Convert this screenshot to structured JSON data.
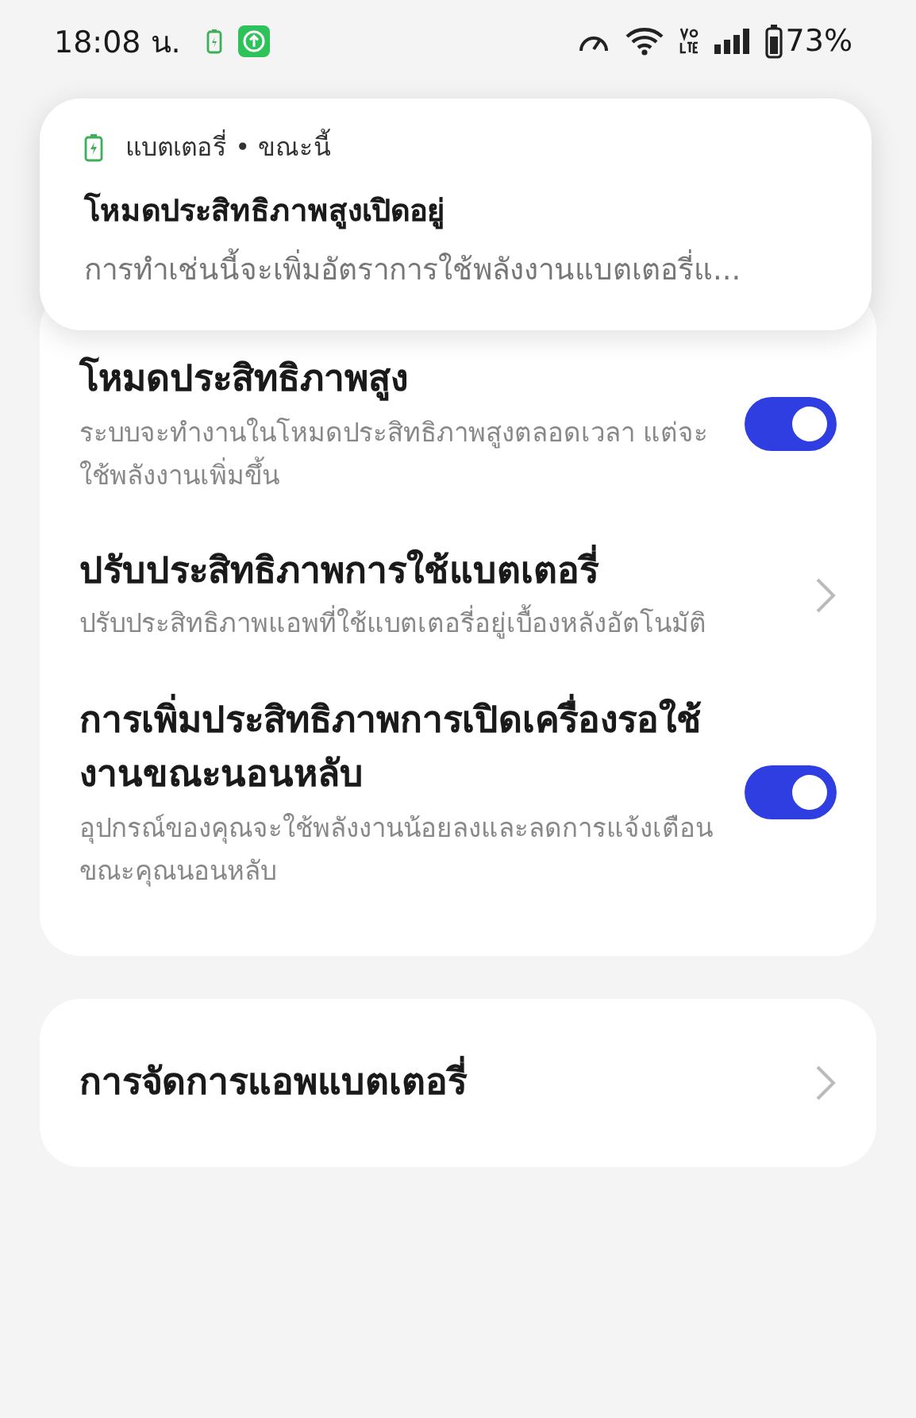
{
  "status_bar": {
    "time": "18:08 น.",
    "battery": "73%"
  },
  "notification": {
    "app": "แบตเตอรี่ • ขณะนี้",
    "title": "โหมดประสิทธิภาพสูงเปิดอยู่",
    "text": "การทำเช่นนี้จะเพิ่มอัตราการใช้พลังงานแบตเตอรี่แ..."
  },
  "settings": [
    {
      "kind": "toggle",
      "title": "โหมดประสิทธิภาพสูง",
      "description": "ระบบจะทำงานในโหมดประสิทธิภาพสูงตลอดเวลา แต่จะใช้พลังงานเพิ่มขึ้น",
      "on": true
    },
    {
      "kind": "link",
      "title": "ปรับประสิทธิภาพการใช้แบตเตอรี่",
      "description": "ปรับประสิทธิภาพแอพที่ใช้แบตเตอรี่อยู่เบื้องหลังอัตโนมัติ"
    },
    {
      "kind": "toggle",
      "title": "การเพิ่มประสิทธิภาพการเปิดเครื่องรอใช้งานขณะนอนหลับ",
      "description": "อุปกรณ์ของคุณจะใช้พลังงานน้อยลงและลดการแจ้งเตือนขณะคุณนอนหลับ",
      "on": true
    }
  ],
  "more": [
    {
      "kind": "link",
      "title": "การจัดการแอพแบตเตอรี่"
    }
  ]
}
